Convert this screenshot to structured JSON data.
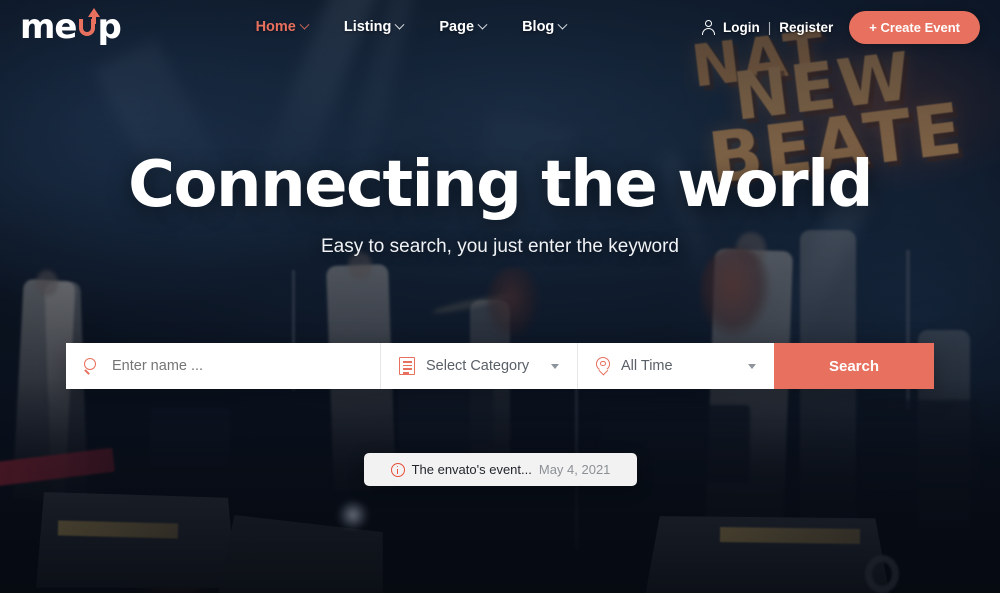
{
  "header": {
    "logo": {
      "text_left": "me",
      "letter_u": "U",
      "text_right": "p",
      "accent": "#e8705e"
    },
    "nav": [
      {
        "label": "Home",
        "active": true,
        "icon": "chevron-down-icon"
      },
      {
        "label": "Listing",
        "active": false,
        "icon": "chevron-down-icon"
      },
      {
        "label": "Page",
        "active": false,
        "icon": "chevron-down-icon"
      },
      {
        "label": "Blog",
        "active": false,
        "icon": "chevron-down-icon"
      }
    ],
    "account": {
      "icon": "user-icon",
      "login_label": "Login",
      "separator": "|",
      "register_label": "Register"
    },
    "create_event_label": "+ Create Event"
  },
  "hero": {
    "title": "Connecting the world",
    "subtitle": "Easy to search, you just enter the keyword"
  },
  "search": {
    "name_icon": "search-icon",
    "name_placeholder": "Enter name ...",
    "name_value": "",
    "category_icon": "list-document-icon",
    "category_value": "Select Category",
    "time_icon": "map-pin-icon",
    "time_value": "All Time",
    "button_label": "Search",
    "button_color": "#e8705e"
  },
  "toast": {
    "icon": "info-circle-icon",
    "title": "The envato's event...",
    "date": "May 4, 2021"
  },
  "background": {
    "sign_line1": "NAT",
    "sign_line2": "NEW",
    "sign_line3": "BEATE"
  }
}
